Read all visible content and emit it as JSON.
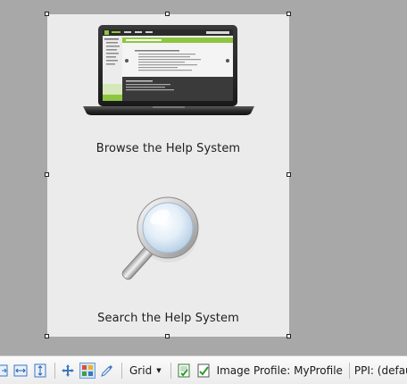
{
  "tiles": [
    {
      "label": "Browse the Help System",
      "icon": "laptop-icon"
    },
    {
      "label": "Search the Help System",
      "icon": "magnifying-glass-icon"
    }
  ],
  "statusbar": {
    "icons": [
      "fit-page-icon",
      "fit-width-icon",
      "fit-height-icon",
      "pan-icon",
      "color-swatch-icon",
      "eyedropper-icon"
    ],
    "grid_label": "Grid",
    "image_profile": "Image Profile: MyProfile",
    "ppi": "PPI: (default)"
  },
  "colors": {
    "canvas": "#a8a8a8",
    "page": "#ebebeb",
    "accent_green": "#8dc63f"
  }
}
